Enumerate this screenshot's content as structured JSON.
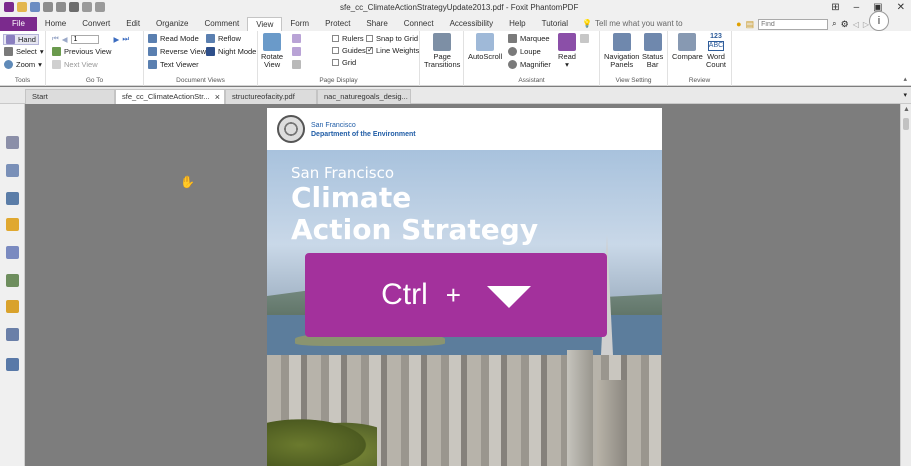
{
  "title_bar": {
    "title": "sfe_cc_ClimateActionStrategyUpdate2013.pdf - Foxit PhantomPDF"
  },
  "menu": {
    "tabs": [
      "File",
      "Home",
      "Convert",
      "Edit",
      "Organize",
      "Comment",
      "View",
      "Form",
      "Protect",
      "Share",
      "Connect",
      "Accessibility",
      "Help",
      "Tutorial"
    ],
    "active": "View",
    "tell_me": "Tell me what you want to",
    "find_placeholder": "Find"
  },
  "ribbon": {
    "tools": {
      "hand": "Hand",
      "select": "Select",
      "zoom": "Zoom",
      "label": "Tools"
    },
    "goto": {
      "page_value": "1",
      "previous_view": "Previous View",
      "next_view": "Next View",
      "label": "Go To"
    },
    "document_views": {
      "read_mode": "Read Mode",
      "reverse_view": "Reverse View",
      "text_viewer": "Text Viewer",
      "reflow": "Reflow",
      "night_mode": "Night Mode",
      "label": "Document Views"
    },
    "page_display": {
      "rotate_view_1": "Rotate",
      "rotate_view_2": "View",
      "rulers": "Rulers",
      "guides": "Guides",
      "grid": "Grid",
      "snap_to_grid": "Snap to Grid",
      "line_weights": "Line Weights",
      "page_transitions_1": "Page",
      "page_transitions_2": "Transitions",
      "label": "Page Display"
    },
    "assistant": {
      "autoscroll": "AutoScroll",
      "marquee": "Marquee",
      "loupe": "Loupe",
      "magnifier": "Magnifier",
      "read": "Read",
      "label": "Assistant"
    },
    "view_setting": {
      "navigation_panels_1": "Navigation",
      "navigation_panels_2": "Panels",
      "status_bar_1": "Status",
      "status_bar_2": "Bar",
      "label": "View Setting"
    },
    "review": {
      "compare": "Compare",
      "word_count_top": "123",
      "word_count_mid": "ABC",
      "word_count_1": "Word",
      "word_count_2": "Count",
      "label": "Review"
    }
  },
  "doc_tabs": [
    {
      "label": "Start"
    },
    {
      "label": "sfe_cc_ClimateActionStr..."
    },
    {
      "label": "structureofacity.pdf"
    },
    {
      "label": "nac_naturegoals_desig..."
    }
  ],
  "document": {
    "org_line1": "San Francisco",
    "org_line2": "Department of the Environment",
    "cover_subtitle": "San Francisco",
    "cover_title_1": "Climate",
    "cover_title_2": "Action Strategy"
  },
  "overlay": {
    "key": "Ctrl",
    "plus": "+",
    "color": "#a3319c"
  },
  "colors": {
    "file_tab": "#7b2a8d",
    "org_text": "#1f5ca6"
  }
}
